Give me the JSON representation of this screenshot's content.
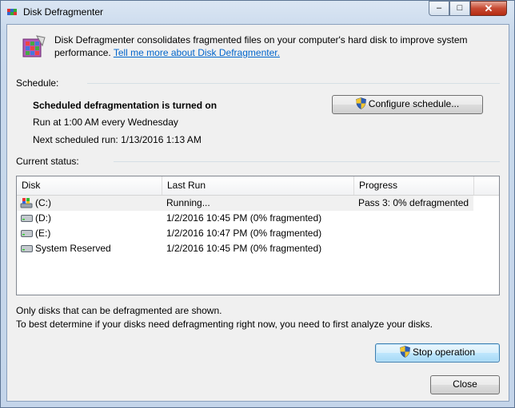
{
  "window": {
    "title": "Disk Defragmenter",
    "controls": {
      "minimize": "–",
      "maximize": "□",
      "close": "✕"
    }
  },
  "intro": {
    "text": "Disk Defragmenter consolidates fragmented files on your computer's hard disk to improve system",
    "text_line2": "performance.",
    "link": "Tell me more about Disk Defragmenter."
  },
  "schedule": {
    "heading": "Schedule:",
    "status": "Scheduled defragmentation is turned on",
    "run_at": "Run at 1:00 AM every Wednesday",
    "next_run": "Next scheduled run: 1/13/2016 1:13 AM",
    "configure_button": "Configure schedule..."
  },
  "current_status": {
    "heading": "Current status:",
    "columns": [
      "Disk",
      "Last Run",
      "Progress"
    ],
    "rows": [
      {
        "disk": "(C:)",
        "last_run": "Running...",
        "progress": "Pass 3: 0% defragmented",
        "icon": "system-drive-icon"
      },
      {
        "disk": "(D:)",
        "last_run": "1/2/2016 10:45 PM (0% fragmented)",
        "progress": "",
        "icon": "drive-icon"
      },
      {
        "disk": "(E:)",
        "last_run": "1/2/2016 10:47 PM (0% fragmented)",
        "progress": "",
        "icon": "drive-icon"
      },
      {
        "disk": "System Reserved",
        "last_run": "1/2/2016 10:45 PM (0% fragmented)",
        "progress": "",
        "icon": "drive-icon"
      }
    ]
  },
  "footer": {
    "note1": "Only disks that can be defragmented are shown.",
    "note2": "To best determine if your disks need defragmenting right now, you need to first analyze your disks.",
    "stop_button": "Stop operation",
    "close_button": "Close"
  },
  "colors": {
    "link": "#0066cc",
    "selected_row": "#f0f0f0",
    "title_bar": "#c9d9ec"
  }
}
